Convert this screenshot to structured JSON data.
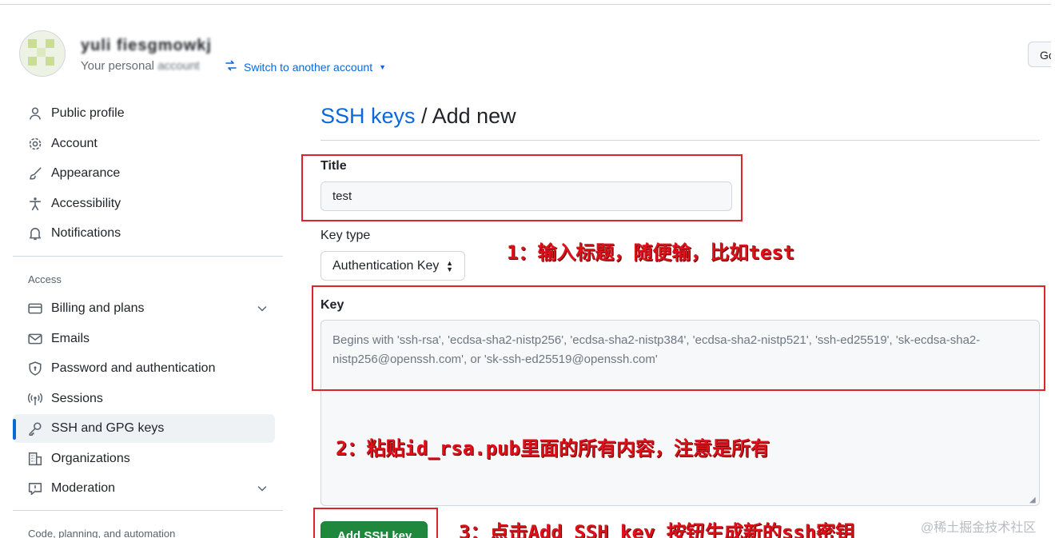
{
  "header": {
    "account_name": "yuli fiesgmowkj",
    "account_sub_visible": "Your personal",
    "account_sub_blurred": "account",
    "switch_label": "Switch to another account",
    "goto_button": "Go"
  },
  "sidebar": {
    "items": [
      {
        "label": "Public profile",
        "icon": "person-icon"
      },
      {
        "label": "Account",
        "icon": "gear-icon"
      },
      {
        "label": "Appearance",
        "icon": "paintbrush-icon"
      },
      {
        "label": "Accessibility",
        "icon": "accessibility-icon"
      },
      {
        "label": "Notifications",
        "icon": "bell-icon"
      }
    ],
    "access_label": "Access",
    "access_items": [
      {
        "label": "Billing and plans",
        "icon": "credit-card-icon"
      },
      {
        "label": "Emails",
        "icon": "mail-icon"
      },
      {
        "label": "Password and authentication",
        "icon": "shield-lock-icon"
      },
      {
        "label": "Sessions",
        "icon": "broadcast-icon"
      },
      {
        "label": "SSH and GPG keys",
        "icon": "key-icon",
        "active": true
      },
      {
        "label": "Organizations",
        "icon": "organization-icon"
      },
      {
        "label": "Moderation",
        "icon": "report-icon"
      }
    ],
    "automation_label": "Code, planning, and automation"
  },
  "main": {
    "breadcrumb_link": "SSH keys",
    "breadcrumb_sep": " / ",
    "breadcrumb_current": "Add new",
    "title_label": "Title",
    "title_value": "test",
    "key_type_label": "Key type",
    "key_type_value": "Authentication Key",
    "key_label": "Key",
    "key_placeholder": "Begins with 'ssh-rsa', 'ecdsa-sha2-nistp256', 'ecdsa-sha2-nistp384', 'ecdsa-sha2-nistp521', 'ssh-ed25519', 'sk-ecdsa-sha2-nistp256@openssh.com', or 'sk-ssh-ed25519@openssh.com'",
    "submit_label": "Add SSH key"
  },
  "annotations": {
    "note1": "1：输入标题，随便输，比如test",
    "note2": "2：粘贴id_rsa.pub里面的所有内容，注意是所有",
    "note3": "3：点击Add SSH key 按钮生成新的ssh密钥",
    "color": "#e0101a"
  },
  "watermark": "@稀土掘金技术社区",
  "colors": {
    "accent": "#0969da",
    "primary_button": "#1f883d",
    "annotation_red": "#e0222a"
  }
}
